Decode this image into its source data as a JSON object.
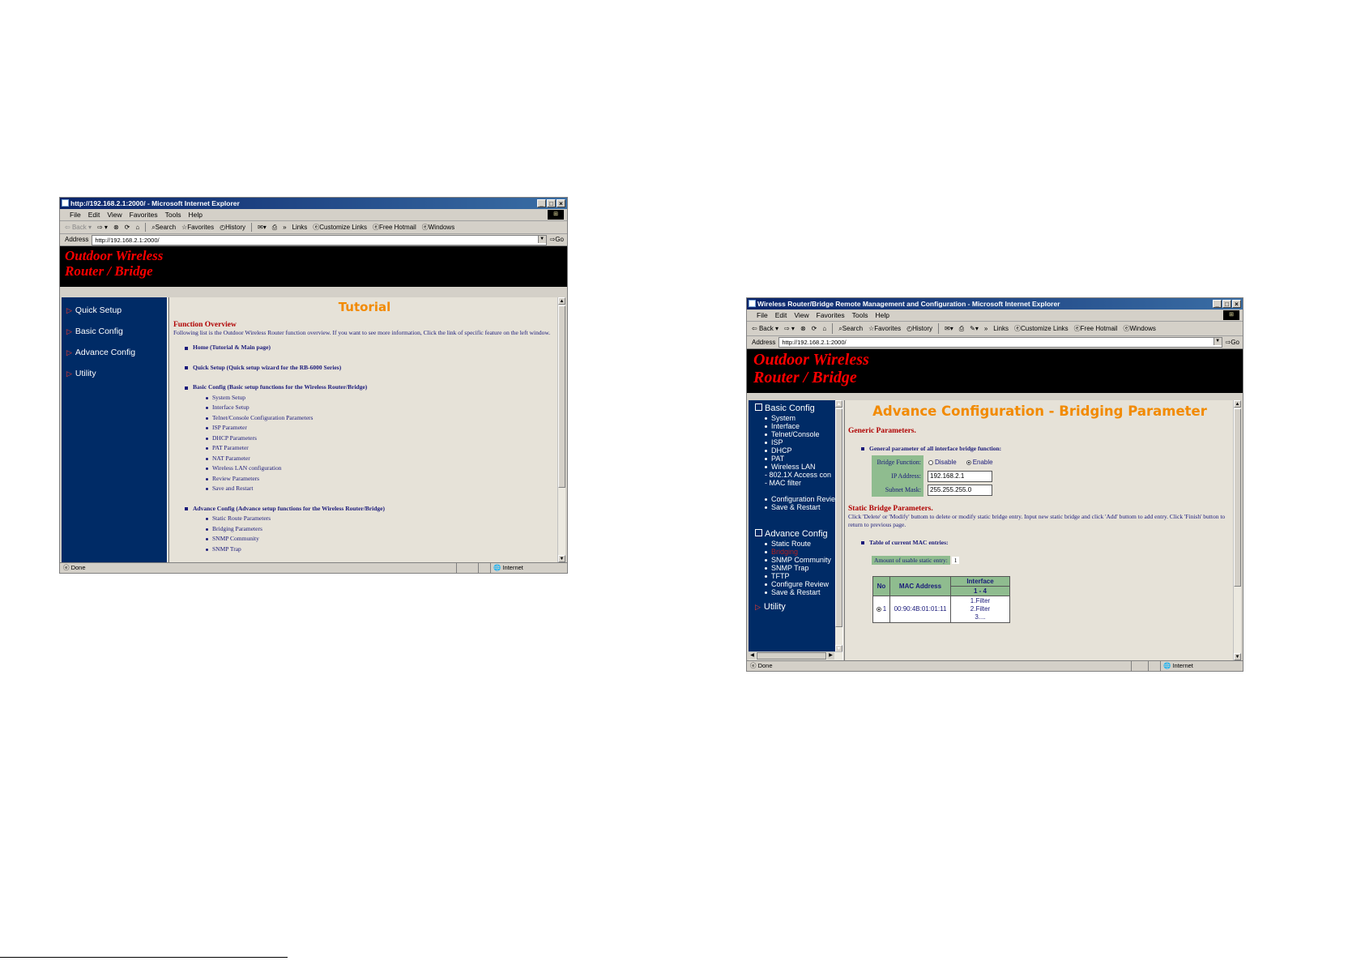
{
  "win1": {
    "title": "http://192.168.2.1:2000/ - Microsoft Internet Explorer",
    "menu": [
      "File",
      "Edit",
      "View",
      "Favorites",
      "Tools",
      "Help"
    ],
    "toolbar": [
      "Back",
      "Forward",
      "Stop",
      "Refresh",
      "Home",
      "Search",
      "Favorites",
      "History",
      "Mail",
      "Print",
      "»",
      "Links",
      "Customize Links",
      "Free Hotmail",
      "Windows"
    ],
    "address_label": "Address",
    "address": "http://192.168.2.1:2000/",
    "go": "Go",
    "banner": [
      "Outdoor Wireless",
      "Router / Bridge"
    ],
    "nav": [
      "Quick Setup",
      "Basic Config",
      "Advance Config",
      "Utility"
    ],
    "page_title": "Tutorial",
    "overview_heading": "Function Overview",
    "overview_text": "Following list is the Outdoor Wireless Router function overview. If you want to see more information, Click the link of specific feature on the left window.",
    "sections": [
      {
        "title": "Home (Tutorial & Main page)",
        "items": []
      },
      {
        "title": "Quick Setup (Quick setup wizard for the RB-6000 Series)",
        "items": []
      },
      {
        "title": "Basic Config (Basic setup functions for the Wireless Router/Bridge)",
        "items": [
          "System Setup",
          "Interface Setup",
          "Telnet/Console Configuration Parameters",
          "ISP Parameter",
          "DHCP Parameters",
          "PAT Parameter",
          "NAT Parameter",
          "Wireless LAN configuration",
          "Review Parameters",
          "Save and Restart"
        ]
      },
      {
        "title": "Advance Config (Advance setup functions for the Wireless Router/Bridge)",
        "items": [
          "Static Route Parameters",
          "Bridging Parameters",
          "SNMP Community",
          "SNMP Trap"
        ]
      }
    ],
    "status": "Done",
    "zone": "Internet"
  },
  "win2": {
    "title": "Wireless Router/Bridge Remote Management and Configuration - Microsoft Internet Explorer",
    "menu": [
      "File",
      "Edit",
      "View",
      "Favorites",
      "Tools",
      "Help"
    ],
    "toolbar": [
      "Back",
      "Forward",
      "Stop",
      "Refresh",
      "Home",
      "Search",
      "Favorites",
      "History",
      "Mail",
      "Print",
      "Edit",
      "»",
      "Links",
      "Customize Links",
      "Free Hotmail",
      "Windows"
    ],
    "address_label": "Address",
    "address": "http://192.168.2.1:2000/",
    "go": "Go",
    "banner": [
      "Outdoor Wireless",
      "Router / Bridge"
    ],
    "nav": {
      "basic_title": "Basic Config",
      "basic_items": [
        "System",
        "Interface",
        "Telnet/Console",
        "ISP",
        "DHCP",
        "PAT",
        "Wireless LAN"
      ],
      "wlan_sub": [
        "- 802.1X Access con",
        "- MAC filter"
      ],
      "basic_items2": [
        "Configuration Revie",
        "Save & Restart"
      ],
      "advance_title": "Advance Config",
      "advance_items": [
        "Static Route",
        "Bridging",
        "SNMP Community",
        "SNMP Trap",
        "TFTP",
        "Configure Review",
        "Save & Restart"
      ],
      "utility": "Utility"
    },
    "page_title": "Advance Configuration - Bridging Parameter",
    "generic_heading": "Generic Parameters.",
    "generic_bullet": "General parameter of all interface bridge function:",
    "bridge_function_label": "Bridge Function:",
    "disable": "Disable",
    "enable": "Enable",
    "ip_label": "IP Address:",
    "ip_value": "192.168.2.1",
    "mask_label": "Subnet Mask:",
    "mask_value": "255.255.255.0",
    "static_heading": "Static Bridge Parameters.",
    "static_text": "Click 'Delete' or 'Modify' buttom to delete or modify static bridge entry. Input new static bridge and click 'Add' buttom to add entry. Click 'Finish' button to return to previous page.",
    "table_bullet": "Table of current MAC entries:",
    "usable_label": "Amount of usable static entry:",
    "usable_value": "1",
    "table": {
      "h_no": "No",
      "h_mac": "MAC Address",
      "h_iface": "Interface",
      "h_range": "1 - 4",
      "row_no": "1",
      "row_mac": "00:90:4B:01:01:11",
      "row_iface": [
        "1.Filter",
        "2.Filter",
        "3...."
      ]
    },
    "status": "Done",
    "zone": "Internet"
  }
}
